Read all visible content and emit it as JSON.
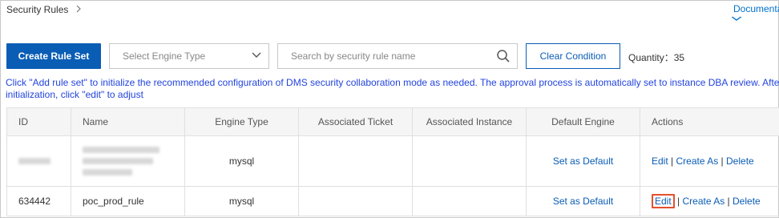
{
  "header": {
    "breadcrumb": "Security Rules",
    "doc_link": "Documenta"
  },
  "toolbar": {
    "create_label": "Create Rule Set",
    "engine_placeholder": "Select Engine Type",
    "search_placeholder": "Search by security rule name",
    "clear_label": "Clear Condition",
    "quantity_label": "Quantity：",
    "quantity_value": "35"
  },
  "info": {
    "line1": "Click \"Add rule set\" to initialize the recommended configuration of DMS security collaboration mode as needed. The approval process is automatically set to instance DBA review. After",
    "line2": "initialization, click \"edit\" to adjust"
  },
  "table": {
    "columns": [
      "ID",
      "Name",
      "Engine Type",
      "Associated Ticket",
      "Associated Instance",
      "Default Engine",
      "Actions"
    ],
    "rows": [
      {
        "id": "",
        "name": "",
        "engine": "mysql",
        "ticket": "",
        "instance": "",
        "default": "Set as Default",
        "edit": "Edit",
        "sep1": "|",
        "create_as": "Create As",
        "sep2": "|",
        "delete": "Delete"
      },
      {
        "id": "634442",
        "name": "poc_prod_rule",
        "engine": "mysql",
        "ticket": "",
        "instance": "",
        "default": "Set as Default",
        "edit": "Edit",
        "sep1": "|",
        "create_as": "Create As",
        "sep2": "|",
        "delete": "Delete"
      }
    ]
  },
  "icons": {
    "breadcrumb_sep": "chevron-right-icon",
    "dropdown": "chevron-down-icon",
    "search": "search-icon"
  }
}
